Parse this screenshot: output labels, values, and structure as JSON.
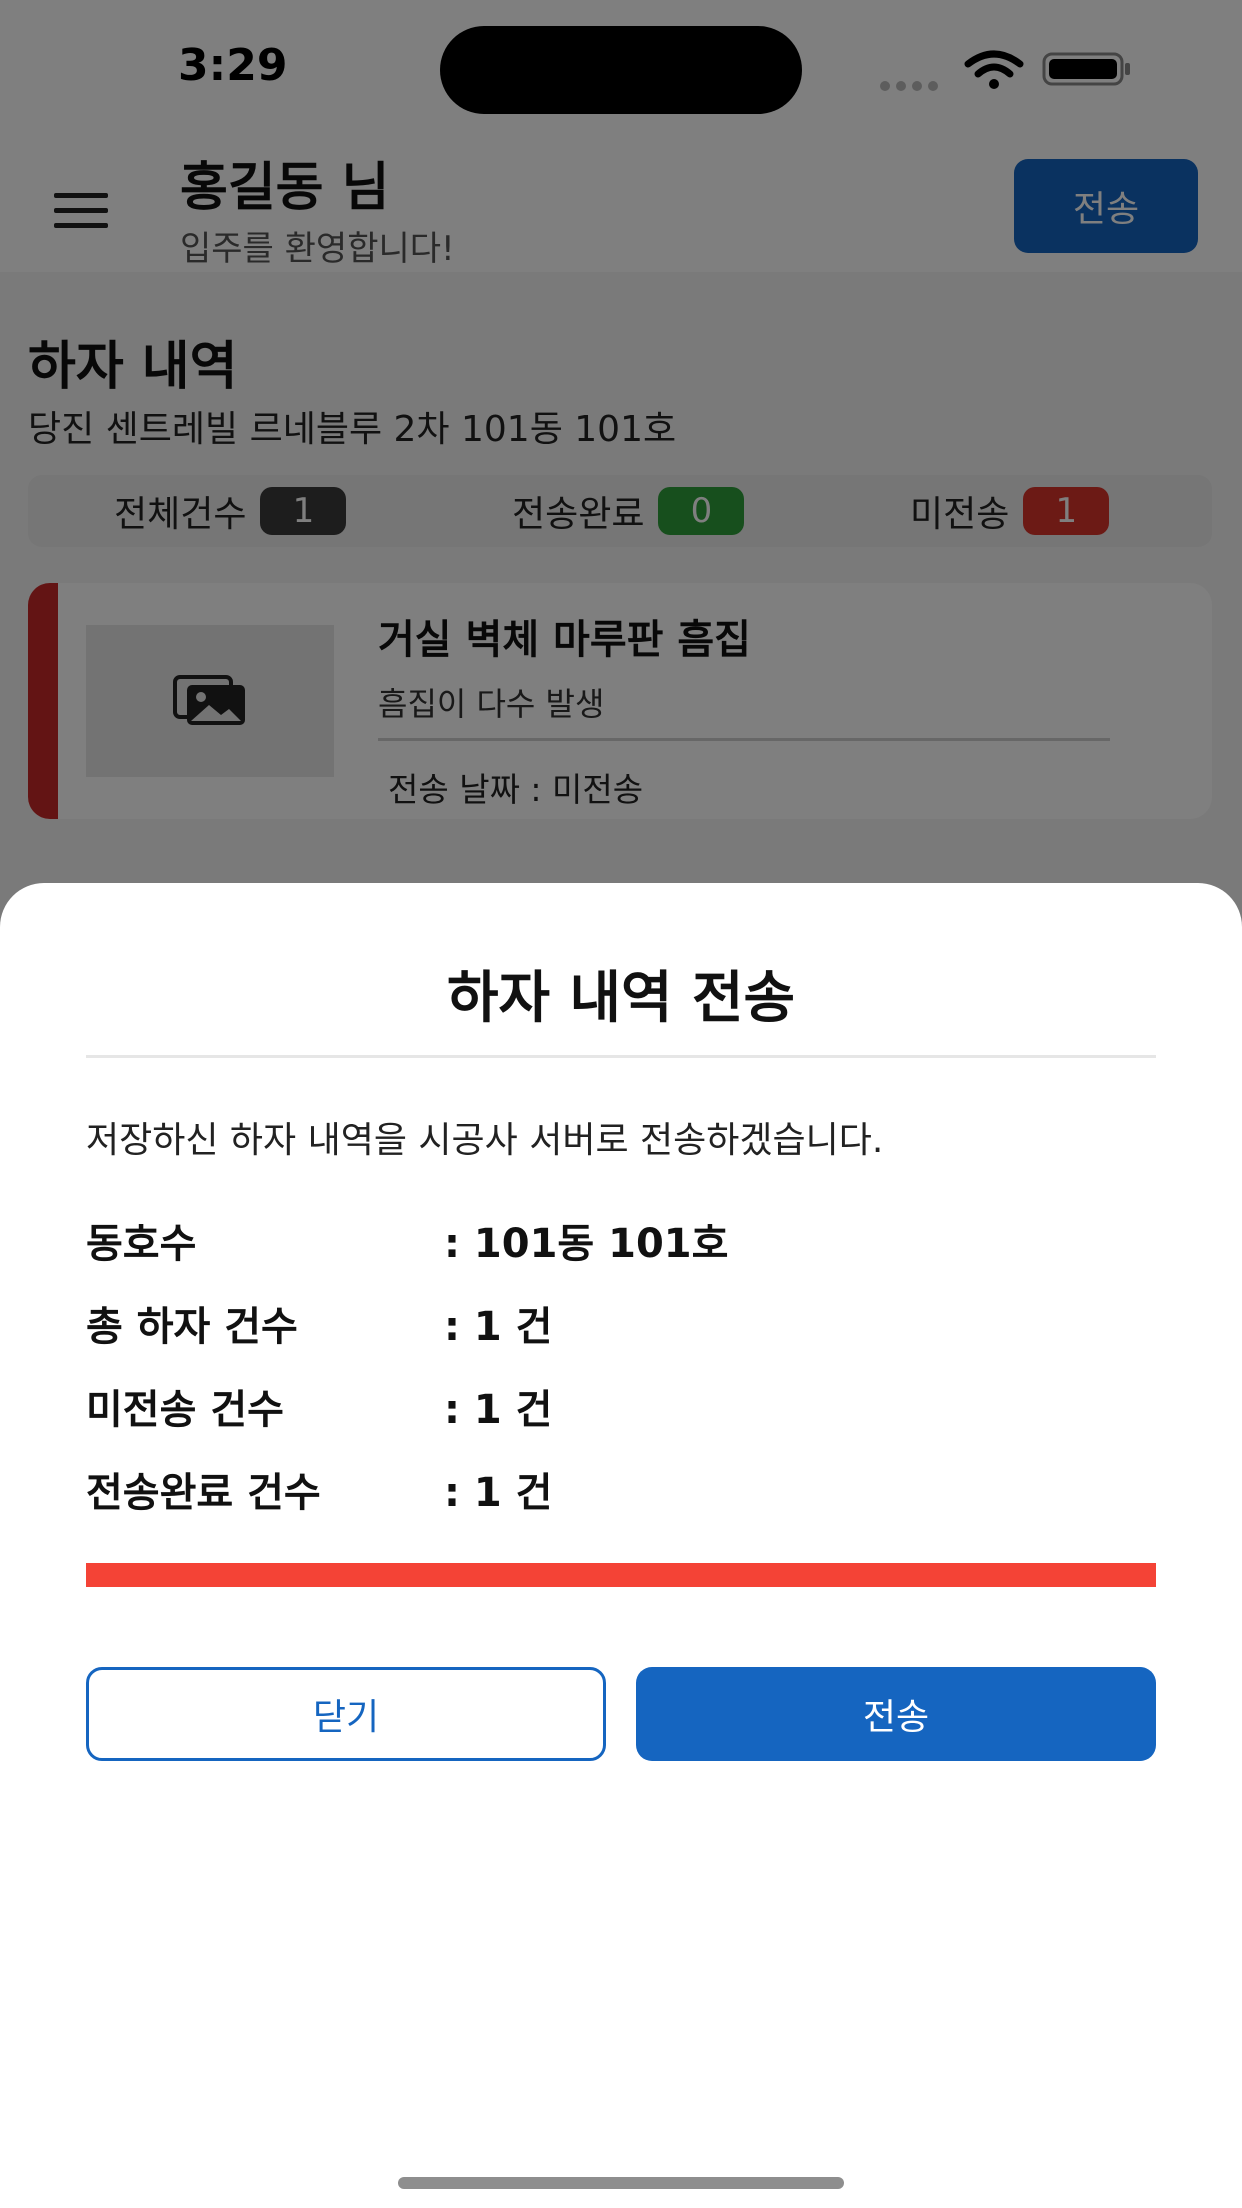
{
  "status_bar": {
    "time": "3:29"
  },
  "header": {
    "user_name": "홍길동 님",
    "welcome": "입주를 환영합니다!",
    "send_label": "전송"
  },
  "content": {
    "title": "하자 내역",
    "address": "당진 센트레빌 르네블루 2차 101동 101호",
    "stats": [
      {
        "label": "전체건수",
        "count": "1",
        "color": "#3a3a3a"
      },
      {
        "label": "전송완료",
        "count": "0",
        "color": "#2e9e3a"
      },
      {
        "label": "미전송",
        "count": "1",
        "color": "#d9342a"
      }
    ],
    "item": {
      "title": "거실 벽체 마루판 흠집",
      "description": "흠집이 다수 발생",
      "date_line": "전송 날짜 : 미전송",
      "stripe_color": "#c62828",
      "thumbnail_icon": "image-gallery-icon"
    }
  },
  "sheet": {
    "title": "하자 내역 전송",
    "message": "저장하신 하자 내역을 시공사 서버로 전송하겠습니다.",
    "rows": [
      {
        "label": "동호수",
        "value": ": 101동 101호"
      },
      {
        "label": "총 하자 건수",
        "value": ": 1 건"
      },
      {
        "label": "미전송 건수",
        "value": ": 1 건"
      },
      {
        "label": "전송완료 건수",
        "value": ": 1 건"
      }
    ],
    "alert_color": "#f44336",
    "close_label": "닫기",
    "send_label": "전송",
    "accent": "#1565c0"
  }
}
